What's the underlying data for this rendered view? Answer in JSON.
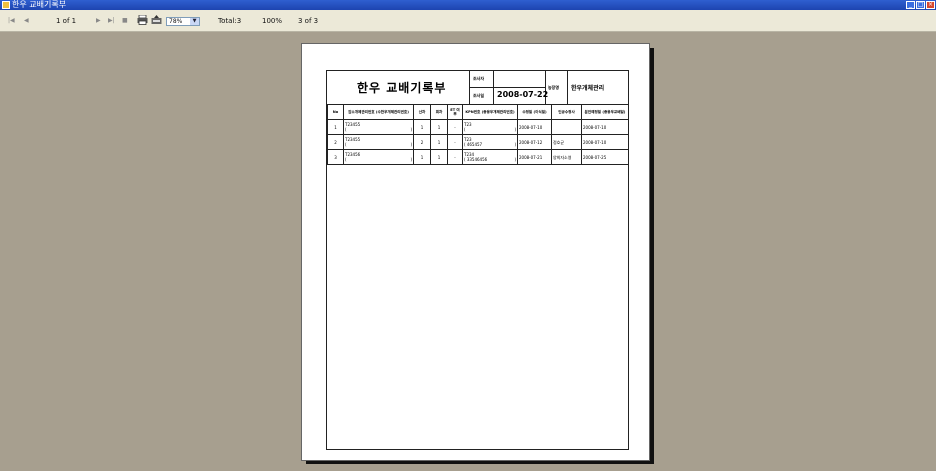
{
  "window": {
    "title": "한우 교배기록부"
  },
  "toolbar": {
    "page_indicator": "1 of 1",
    "zoom": "78%",
    "total": "Total:3",
    "percent": "100%",
    "count": "3 of 3"
  },
  "report": {
    "title": "한우 교배기록부",
    "inspector_label": "조사자",
    "inspection_date_label": "조사일",
    "inspection_date": "2008-07-22",
    "farm_label": "농장명",
    "farm_name": "한우개체관리",
    "columns": [
      "No",
      "암소개체관리번호 (수한우개체관리번호)",
      "산차",
      "회차",
      "ET 여부",
      "KPN번호 (종웅우개체관리번호)",
      "수정일 (이식일)",
      "인공수정사",
      "분만예정일 (종웅우교배일)"
    ],
    "rows": [
      {
        "no": "1",
        "cow_id": "T23455",
        "cow_sub": "(",
        "cow_sub_end": ")",
        "parity": "1",
        "count": "1",
        "et": "-",
        "kpn": "T23",
        "kpn_sub": "(",
        "kpn_sub_end": ")",
        "date": "2008-07-10",
        "technician": "",
        "due": "2008-07-10"
      },
      {
        "no": "2",
        "cow_id": "T23455",
        "cow_sub": "(",
        "cow_sub_end": ")",
        "parity": "2",
        "count": "1",
        "et": "-",
        "kpn": "T23",
        "kpn_sub": "( 465457",
        "kpn_sub_end": ")",
        "date": "2008-07-12",
        "technician": "정호균",
        "due": "2008-07-10"
      },
      {
        "no": "3",
        "cow_id": "T23456",
        "cow_sub": "(",
        "cow_sub_end": ")",
        "parity": "1",
        "count": "1",
        "et": "-",
        "kpn": "T234",
        "kpn_sub": "( 33546456",
        "kpn_sub_end": ")",
        "date": "2008-07-21",
        "technician": "양희자소영",
        "due": "2008-07-25"
      }
    ]
  },
  "icons": {
    "print": "printer-icon",
    "export": "export-icon",
    "nav": [
      "first-page-icon",
      "prev-page-icon",
      "next-page-icon",
      "last-page-icon",
      "stop-icon"
    ]
  }
}
